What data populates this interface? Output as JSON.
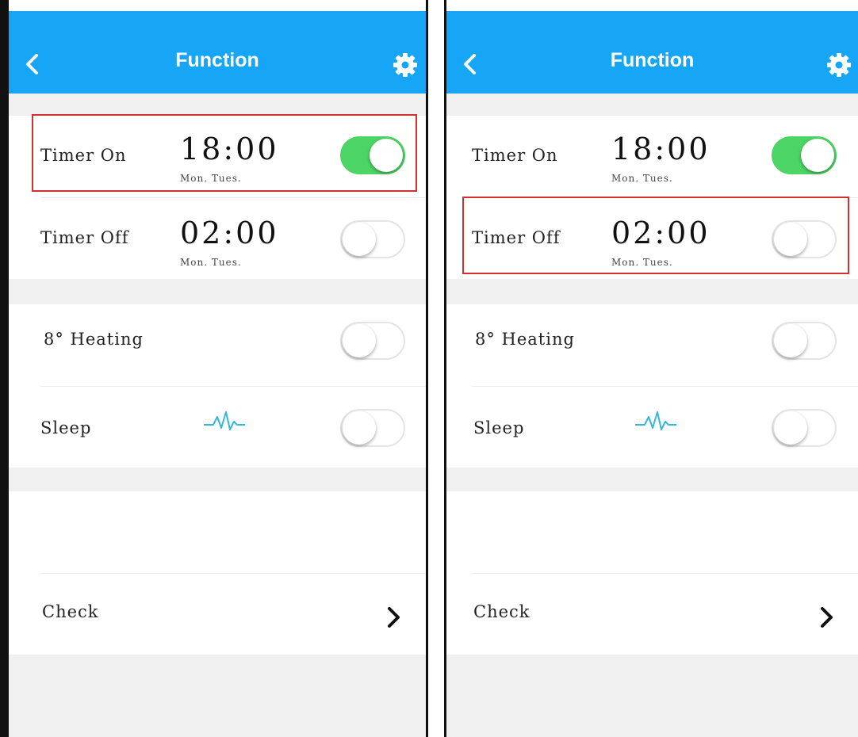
{
  "screens": [
    {
      "header": {
        "title": "Function",
        "back_icon": "chevron-left-icon",
        "settings_icon": "gear-icon"
      },
      "timer_on": {
        "label": "Timer On",
        "time": "18:00",
        "days": "Mon. Tues.",
        "enabled": true
      },
      "timer_off": {
        "label": "Timer Off",
        "time": "02:00",
        "days": "Mon. Tues.",
        "enabled": false
      },
      "heating": {
        "label": "8° Heating",
        "enabled": false
      },
      "sleep": {
        "label": "Sleep",
        "icon": "pulse-icon",
        "enabled": false
      },
      "check": {
        "label": "Check",
        "icon": "chevron-right-icon"
      },
      "highlighted_row": "timer_on"
    },
    {
      "header": {
        "title": "Function",
        "back_icon": "chevron-left-icon",
        "settings_icon": "gear-icon"
      },
      "timer_on": {
        "label": "Timer On",
        "time": "18:00",
        "days": "Mon. Tues.",
        "enabled": true
      },
      "timer_off": {
        "label": "Timer Off",
        "time": "02:00",
        "days": "Mon. Tues.",
        "enabled": false
      },
      "heating": {
        "label": "8° Heating",
        "enabled": false
      },
      "sleep": {
        "label": "Sleep",
        "icon": "pulse-icon",
        "enabled": false
      },
      "check": {
        "label": "Check",
        "icon": "chevron-right-icon"
      },
      "highlighted_row": "timer_off"
    }
  ],
  "colors": {
    "header": "#16a6f5",
    "toggle_on": "#4cd464",
    "highlight": "#d3312f",
    "pulse": "#33b8d8",
    "background": "#f0f0f0"
  }
}
